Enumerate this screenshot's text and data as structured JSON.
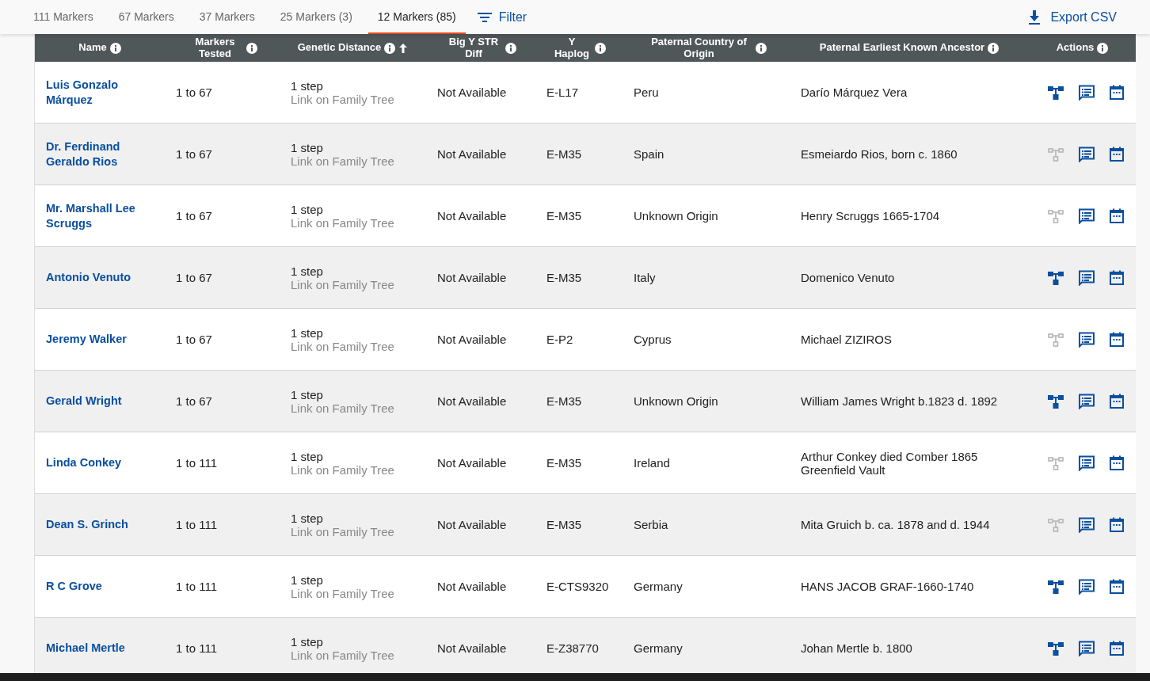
{
  "tabs": [
    {
      "label": "111 Markers",
      "selected": false
    },
    {
      "label": "67 Markers",
      "selected": false
    },
    {
      "label": "37 Markers",
      "selected": false
    },
    {
      "label": "25 Markers (3)",
      "selected": false
    },
    {
      "label": "12 Markers (85)",
      "selected": true
    }
  ],
  "filter_button": "Filter",
  "export_button": "Export CSV",
  "table": {
    "columns": [
      {
        "label": "Name"
      },
      {
        "label": "Markers Tested"
      },
      {
        "label": "Genetic Distance",
        "sorted": true
      },
      {
        "label": "Big Y STR Diff"
      },
      {
        "label": "Y Haplog"
      },
      {
        "label": "Paternal Country of Origin"
      },
      {
        "label": "Paternal Earliest Known Ancestor"
      },
      {
        "label": "Actions"
      }
    ],
    "rows": [
      {
        "name": "Luis Gonzalo Márquez",
        "markers": "1 to 67",
        "distance": "1 step",
        "link": "Link on Family Tree",
        "big_y": "Not Available",
        "haplogroup": "E-L17",
        "country": "Peru",
        "ancestor": "Darío Márquez Vera",
        "tree_linked": true
      },
      {
        "name": "Dr. Ferdinand Geraldo Rios",
        "markers": "1 to 67",
        "distance": "1 step",
        "link": "Link on Family Tree",
        "big_y": "Not Available",
        "haplogroup": "E-M35",
        "country": "Spain",
        "ancestor": "Esmeiardo Rios, born c. 1860",
        "tree_linked": false
      },
      {
        "name": "Mr. Marshall Lee Scruggs",
        "markers": "1 to 67",
        "distance": "1 step",
        "link": "Link on Family Tree",
        "big_y": "Not Available",
        "haplogroup": "E-M35",
        "country": "Unknown Origin",
        "ancestor": "Henry Scruggs 1665-1704",
        "tree_linked": false
      },
      {
        "name": "Antonio Venuto",
        "markers": "1 to 67",
        "distance": "1 step",
        "link": "Link on Family Tree",
        "big_y": "Not Available",
        "haplogroup": "E-M35",
        "country": "Italy",
        "ancestor": "Domenico Venuto",
        "tree_linked": true
      },
      {
        "name": "Jeremy Walker",
        "markers": "1 to 67",
        "distance": "1 step",
        "link": "Link on Family Tree",
        "big_y": "Not Available",
        "haplogroup": "E-P2",
        "country": "Cyprus",
        "ancestor": "Michael ZIZIROS",
        "tree_linked": false
      },
      {
        "name": "Gerald Wright",
        "markers": "1 to 67",
        "distance": "1 step",
        "link": "Link on Family Tree",
        "big_y": "Not Available",
        "haplogroup": "E-M35",
        "country": "Unknown Origin",
        "ancestor": "William James Wright b.1823 d. 1892",
        "tree_linked": true
      },
      {
        "name": "Linda Conkey",
        "markers": "1 to 111",
        "distance": "1 step",
        "link": "Link on Family Tree",
        "big_y": "Not Available",
        "haplogroup": "E-M35",
        "country": "Ireland",
        "ancestor": "Arthur Conkey died Comber 1865 Greenfield Vault",
        "tree_linked": false
      },
      {
        "name": "Dean S. Grinch",
        "markers": "1 to 111",
        "distance": "1 step",
        "link": "Link on Family Tree",
        "big_y": "Not Available",
        "haplogroup": "E-M35",
        "country": "Serbia",
        "ancestor": "Mita Gruich b. ca. 1878 and d. 1944",
        "tree_linked": false
      },
      {
        "name": "R C Grove",
        "markers": "1 to 111",
        "distance": "1 step",
        "link": "Link on Family Tree",
        "big_y": "Not Available",
        "haplogroup": "E-CTS9320",
        "country": "Germany",
        "ancestor": "HANS JACOB GRAF-1660-1740",
        "tree_linked": true
      },
      {
        "name": "Michael Mertle",
        "markers": "1 to 111",
        "distance": "1 step",
        "link": "Link on Family Tree",
        "big_y": "Not Available",
        "haplogroup": "E-Z38770",
        "country": "Germany",
        "ancestor": "Johan Mertle b. 1800",
        "tree_linked": true
      }
    ]
  }
}
